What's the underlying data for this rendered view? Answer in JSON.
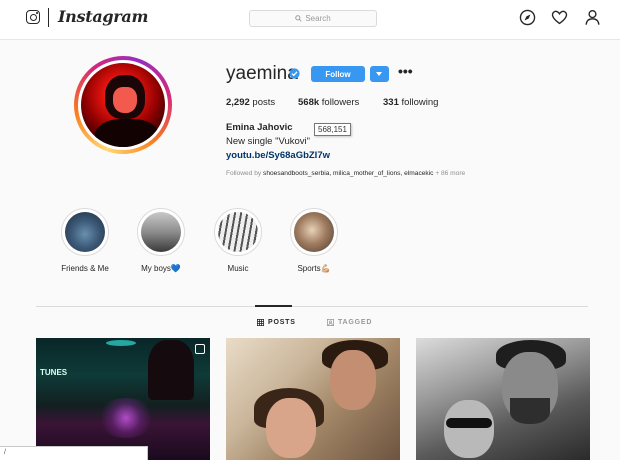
{
  "topbar": {
    "brand": "Instagram",
    "search_placeholder": "Search"
  },
  "profile": {
    "username": "yaemina",
    "verified": true,
    "follow_label": "Follow",
    "stats": {
      "posts_count": "2,292",
      "posts_label": "posts",
      "followers_count": "568k",
      "followers_label": "followers",
      "following_count": "331",
      "following_label": "following"
    },
    "full_name": "Emina Jahovic",
    "followers_tooltip": "568,151",
    "bio": "New single \"Vukovi\"",
    "link": "youtu.be/Sy68aGbZI7w",
    "followed_by": {
      "prefix": "Followed by",
      "names": "shoesandboots_serbia, milica_mother_of_lions, elmacekic",
      "more": "+ 86 more"
    }
  },
  "highlights": [
    {
      "label": "Friends & Me"
    },
    {
      "label": "My boys💙"
    },
    {
      "label": "Music"
    },
    {
      "label": "Sports💪🏼"
    }
  ],
  "tabs": {
    "posts": "POSTS",
    "tagged": "TAGGED",
    "active": "posts"
  },
  "posts": [
    {
      "overlay_text": "TUNES"
    },
    {},
    {}
  ],
  "statusbar": {
    "text": "/"
  },
  "colors": {
    "accent": "#3897f0",
    "link": "#003569",
    "verified": "#3897f0"
  }
}
